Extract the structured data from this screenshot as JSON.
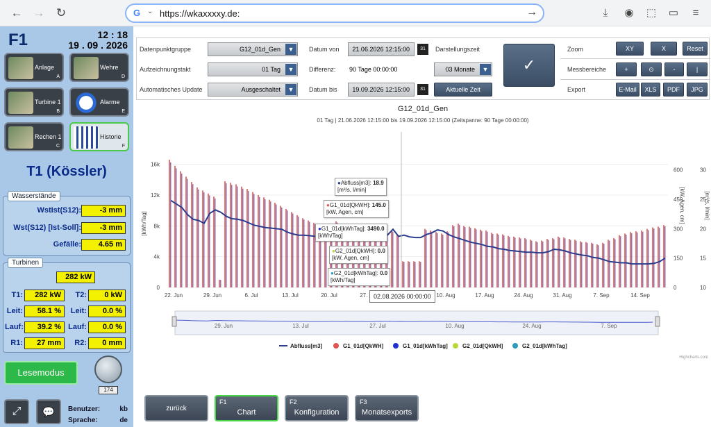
{
  "browser": {
    "url": "https://wkaxxxxy.de:",
    "g": "G",
    "back": "←",
    "forward": "→",
    "reload": "↻",
    "chev": "⌄",
    "go": "→",
    "icons": [
      "⤓",
      "◉",
      "⬚",
      "▭",
      "≡"
    ]
  },
  "left": {
    "title": "F1",
    "time": "12 : 18",
    "date": "19 . 09 . 2026",
    "tiles": [
      {
        "label": "Anlage",
        "key": "A"
      },
      {
        "label": "Wehre",
        "key": "D"
      },
      {
        "label": "Turbine 1",
        "key": "B"
      },
      {
        "label": "Alarme",
        "key": "E"
      },
      {
        "label": "Rechen 1",
        "key": "C"
      },
      {
        "label": "Historie",
        "key": "F"
      }
    ],
    "station": "T1 (Kössler)",
    "wasser": {
      "title": "Wasserstände",
      "rows": [
        {
          "label": "WstIst(S12):",
          "value": "-3 mm"
        },
        {
          "label": "Wst(S12) [Ist-Soll]:",
          "value": "-3 mm"
        },
        {
          "label": "Gefälle:",
          "value": "4.65 m"
        }
      ]
    },
    "turbinen": {
      "title": "Turbinen",
      "total": "282 kW",
      "rows": [
        {
          "l1": "T1:",
          "v1": "282 kW",
          "l2": "T2:",
          "v2": "0 kW"
        },
        {
          "l1": "Leit:",
          "v1": "58.1 %",
          "l2": "Leit:",
          "v2": "0.0 %"
        },
        {
          "l1": "Lauf:",
          "v1": "39.2 %",
          "l2": "Lauf:",
          "v2": "0.0 %"
        },
        {
          "l1": "R1:",
          "v1": "27 mm",
          "l2": "R2:",
          "v2": "0 mm"
        }
      ]
    },
    "lesemodus": "Lesemodus",
    "count": "174",
    "benutzer_label": "Benutzer:",
    "benutzer": "kb",
    "sprache_label": "Sprache:",
    "sprache": "de",
    "expand_icon": "⤢",
    "chat_icon": "💬"
  },
  "toolbar": {
    "dpg_label": "Datenpunktgruppe",
    "dpg": "G12_01d_Gen",
    "takt_label": "Aufzeichnungstakt",
    "takt": "01 Tag",
    "auto_label": "Automatisches Update",
    "auto": "Ausgeschaltet",
    "von_label": "Datum von",
    "von": "21.06.2026 12:15:00",
    "diff_label": "Differenz:",
    "diff": "90 Tage 00:00:00",
    "bis_label": "Datum bis",
    "bis": "19.09.2026 12:15:00",
    "dz_label": "Darstellungszeit",
    "dz": "03 Monate",
    "aktuelle": "Aktuelle Zeit",
    "confirm": "✓",
    "cal": "31",
    "dd": "▼",
    "zoom_label": "Zoom",
    "zoom": [
      "XY",
      "X",
      "Reset"
    ],
    "mess_label": "Messbereiche",
    "mess": [
      "+",
      "⊙",
      "-",
      "|"
    ],
    "export_label": "Export",
    "export": [
      "E-Mail",
      "XLS",
      "PDF",
      "JPG"
    ]
  },
  "chart_data": {
    "type": "bar",
    "title": "G12_01d_Gen",
    "subtitle": "01 Tag | 21.06.2026 12:15:00 bis 19.09.2026 12:15:00 (Zeitspanne: 90 Tage 00:00:00)",
    "x_ticks": [
      "22. Jun",
      "29. Jun",
      "6. Jul",
      "13. Jul",
      "20. Jul",
      "27. Jul",
      "3. Aug",
      "10. Aug",
      "17. Aug",
      "24. Aug",
      "31. Aug",
      "7. Sep",
      "14. Sep"
    ],
    "nav_ticks": [
      "29. Jun",
      "13. Jul",
      "27. Jul",
      "10. Aug",
      "24. Aug",
      "7. Sep"
    ],
    "y_left_ticks": [
      "0",
      "4k",
      "8k",
      "12k",
      "16k"
    ],
    "y_left_label": "[kWh/Tag]",
    "y_mid_ticks": [
      "0",
      "150",
      "300",
      "450",
      "600"
    ],
    "y_mid_label": "[kW, Agen, cm]",
    "y_right_ticks": [
      "10",
      "15",
      "20",
      "25",
      "30"
    ],
    "y_right_label": "[m³/s, l/min]",
    "ylim_left": [
      0,
      16000
    ],
    "kwh_values": [
      16600,
      15800,
      15100,
      14400,
      13700,
      13000,
      12600,
      12200,
      11800,
      1000,
      13800,
      13600,
      13400,
      13100,
      12800,
      12400,
      12000,
      11700,
      11400,
      11000,
      10600,
      10200,
      9800,
      9400,
      9000,
      8700,
      8400,
      8100,
      7800,
      7500,
      8600,
      8300,
      8000,
      7700,
      7400,
      7100,
      7400,
      7700,
      8000,
      7200,
      7400,
      6900,
      3400,
      3400,
      3400,
      3400,
      7600,
      7400,
      7200,
      7000,
      7300,
      8100,
      8300,
      8000,
      7900,
      7700,
      7500,
      7400,
      7100,
      7000,
      6900,
      6700,
      6600,
      6500,
      6400,
      6200,
      6000,
      6100,
      6300,
      6400,
      6600,
      6500,
      6300,
      6200,
      6000,
      5900,
      5800,
      5600,
      5800,
      6200,
      6400,
      6800,
      7000,
      7200,
      7300,
      7400,
      7600,
      7800,
      7900,
      8100
    ],
    "abfluss_values": [
      24.8,
      24.2,
      23.6,
      22.4,
      21.6,
      21.4,
      20.9,
      22.6,
      23.2,
      22.8,
      22.1,
      21.7,
      21.6,
      21.4,
      21.0,
      20.6,
      20.4,
      20.2,
      20.1,
      20.0,
      19.9,
      19.4,
      19.1,
      18.9,
      18.9,
      18.8,
      18.7,
      18.7,
      18.7,
      19.2,
      18.9,
      18.7,
      18.5,
      18.4,
      18.2,
      18.2,
      18.0,
      17.9,
      19.8,
      18.9,
      19.9,
      18.7,
      18.9,
      18.6,
      18.5,
      18.5,
      19.0,
      19.3,
      19.8,
      19.6,
      19.0,
      18.6,
      18.3,
      18.0,
      17.7,
      17.5,
      17.3,
      17.0,
      16.9,
      16.6,
      16.5,
      16.3,
      16.2,
      16.1,
      16.0,
      16.0,
      15.9,
      15.9,
      16.1,
      16.5,
      16.4,
      16.2,
      15.9,
      15.7,
      15.5,
      15.4,
      15.1,
      15.0,
      14.7,
      14.4,
      14.3,
      14.2,
      14.2,
      14.0,
      14.0,
      14.0,
      14.0,
      14.1,
      14.4,
      15.0
    ],
    "legend": [
      {
        "name": "Abfluss[m3]",
        "color": "#2c3c8c",
        "shape": "line"
      },
      {
        "name": "G1_01d[QkWH]",
        "color": "#e0554f",
        "shape": "dot"
      },
      {
        "name": "G1_01d[kWhTag]",
        "color": "#1f2fd0",
        "shape": "dot"
      },
      {
        "name": "G2_01d[QkWH]",
        "color": "#b8d83a",
        "shape": "dot"
      },
      {
        "name": "G2_01d[kWhTag]",
        "color": "#2e9ab8",
        "shape": "dot"
      }
    ],
    "tooltips": [
      {
        "series": "Abfluss[m3]",
        "value": "18.9",
        "unit": "[m³/s, l/min]",
        "color": "#2c3c8c"
      },
      {
        "series": "G1_01d[QkWH]",
        "value": "145.0",
        "unit": "[kW, Agen, cm]",
        "color": "#e0554f"
      },
      {
        "series": "G1_01d[kWhTag]",
        "value": "3490.0",
        "unit": "[kWh/Tag]",
        "color": "#1f2fd0"
      },
      {
        "series": "G2_01d[QkWH]",
        "value": "0.0",
        "unit": "[kW, Agen, cm]",
        "color": "#b8d83a"
      },
      {
        "series": "G2_01d[kWhTag]",
        "value": "0.0",
        "unit": "[kWh/Tag]",
        "color": "#2e9ab8"
      }
    ],
    "crosshair_date": "02.08.2026 00:00:00",
    "credits": "Highcharts.com"
  },
  "bottom": [
    {
      "key": "",
      "label": "zurück"
    },
    {
      "key": "F1",
      "label": "Chart"
    },
    {
      "key": "F2",
      "label": "Konfiguration"
    },
    {
      "key": "F3",
      "label": "Monatsexports"
    }
  ]
}
